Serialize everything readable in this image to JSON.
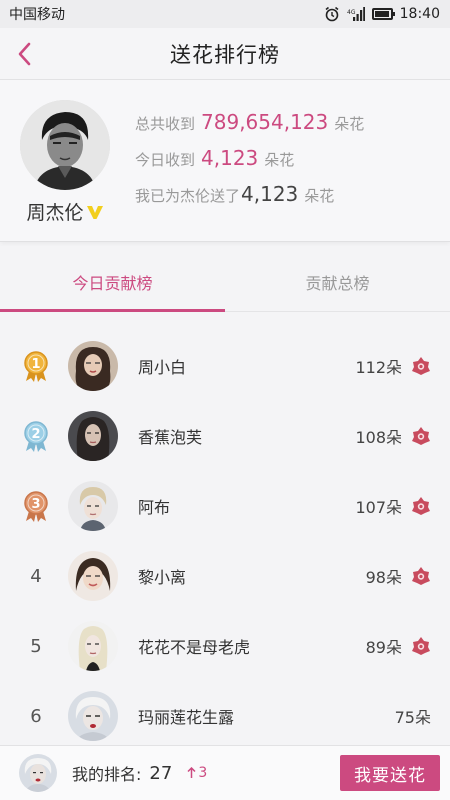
{
  "status_bar": {
    "carrier": "中国移动",
    "time": "18:40"
  },
  "header": {
    "title": "送花排行榜"
  },
  "profile": {
    "name": "周杰伦",
    "total_label": "总共收到",
    "total_value": "789,654,123",
    "total_unit": "朵花",
    "today_label": "今日收到",
    "today_value": "4,123",
    "today_unit": "朵花",
    "mine_label": "我已为杰伦送了",
    "mine_value": "4,123",
    "mine_unit": "朵花"
  },
  "tabs": [
    {
      "label": "今日贡献榜",
      "active": true
    },
    {
      "label": "贡献总榜",
      "active": false
    }
  ],
  "ranking": [
    {
      "rank": "1",
      "medal": "gold-medal-icon",
      "name": "周小白",
      "count": "112朵",
      "has_flower": true
    },
    {
      "rank": "2",
      "medal": "silver-medal-icon",
      "name": "香蕉泡芙",
      "count": "108朵",
      "has_flower": true
    },
    {
      "rank": "3",
      "medal": "bronze-medal-icon",
      "name": "阿布",
      "count": "107朵",
      "has_flower": true
    },
    {
      "rank": "4",
      "medal": "",
      "name": "黎小离",
      "count": "98朵",
      "has_flower": true
    },
    {
      "rank": "5",
      "medal": "",
      "name": "花花不是母老虎",
      "count": "89朵",
      "has_flower": true
    },
    {
      "rank": "6",
      "medal": "",
      "name": "玛丽莲花生露",
      "count": "75朵",
      "has_flower": false
    }
  ],
  "bottom": {
    "my_rank_label": "我的排名:",
    "my_rank_value": "27",
    "rank_change": "3",
    "send_button": "我要送花"
  },
  "colors": {
    "accent": "#cc4a80",
    "gold": "#f0b43c",
    "silver": "#9ccfe6",
    "bronze": "#e0946a",
    "flower": "#c84b5e"
  }
}
